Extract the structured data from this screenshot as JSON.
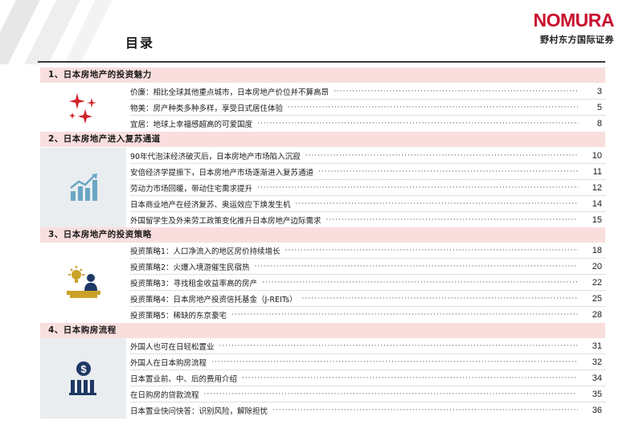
{
  "header": {
    "title": "目录",
    "logo_mark": "NOMURA",
    "logo_sub": "野村东方国际证券"
  },
  "sections": [
    {
      "title": "1、日本房地产的投资魅力",
      "icon": "sparkles-icon",
      "entries": [
        {
          "text": "价廉：相比全球其他重点城市，日本房地产价位并不算高昂",
          "page": "3"
        },
        {
          "text": "物美：房产种类多种多样，享受日式居住体验",
          "page": "5"
        },
        {
          "text": "宜居：地球上幸福感超高的可爱国度",
          "page": "8"
        }
      ]
    },
    {
      "title": "2、日本房地产进入复苏通道",
      "icon": "bar-chart-growth-icon",
      "entries": [
        {
          "text": "90年代泡沫经济破灭后，日本房地产市场陷入沉寂",
          "page": "10"
        },
        {
          "text": "安倍经济学提振下，日本房地产市场逐渐进入复苏通道",
          "page": "11"
        },
        {
          "text": "劳动力市场回暖，带动住宅需求提升",
          "page": "12"
        },
        {
          "text": "日本商业地产在经济复苏、奥运效应下焕发生机",
          "page": "14"
        },
        {
          "text": "外国留学生及外来劳工政策变化推升日本房地产边际需求",
          "page": "15"
        }
      ]
    },
    {
      "title": "3、日本房地产的投资策略",
      "icon": "idea-person-icon",
      "entries": [
        {
          "text": "投资策略1：人口净流入的地区房价持续增长",
          "page": "18"
        },
        {
          "text": "投资策略2：火爆入境游催生民宿热",
          "page": "20"
        },
        {
          "text": "投资策略3：寻找租金收益率高的房产",
          "page": "22"
        },
        {
          "text": "投资策略4：日本房地产投资信托基金（J-REITs）",
          "page": "25"
        },
        {
          "text": "投资策略5：稀缺的东京豪宅",
          "page": "28"
        }
      ]
    },
    {
      "title": "4、日本购房流程",
      "icon": "money-bank-icon",
      "entries": [
        {
          "text": "外国人也可在日轻松置业",
          "page": "31"
        },
        {
          "text": "外国人在日本购房流程",
          "page": "32"
        },
        {
          "text": "日本置业前、中、后的费用介绍",
          "page": "34"
        },
        {
          "text": "在日购房的贷款流程",
          "page": "35"
        },
        {
          "text": "日本置业快问快答：识别风险，解除担忧",
          "page": "36"
        }
      ]
    }
  ],
  "colors": {
    "brand_red": "#c8102e",
    "section_header_bg": "#f9dede",
    "icon_panel_bg": "#e9edf0",
    "icon_navy": "#1f3864",
    "icon_gold": "#c9a227"
  }
}
